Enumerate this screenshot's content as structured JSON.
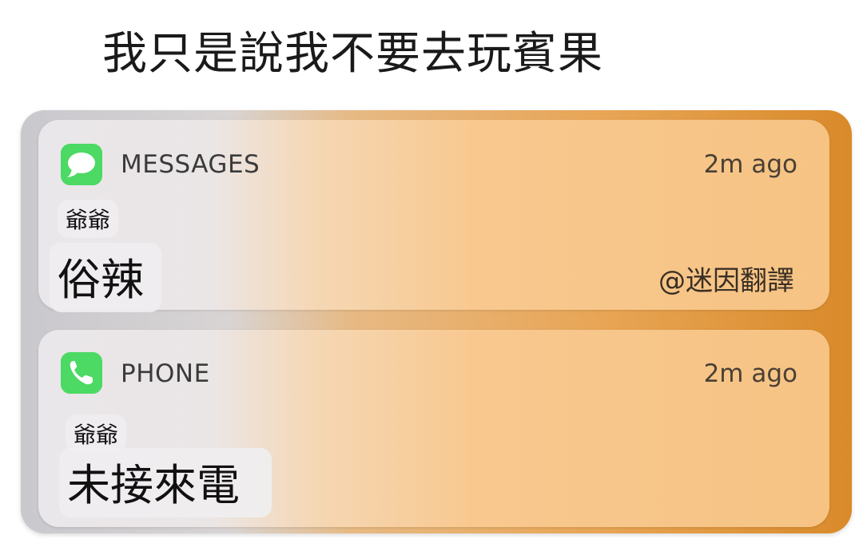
{
  "caption": "我只是說我不要去玩賓果",
  "notifications": [
    {
      "app_icon": "messages-app-icon",
      "app_name": "MESSAGES",
      "time": "2m ago",
      "sender": "爺爺",
      "body": "俗辣"
    },
    {
      "app_icon": "phone-app-icon",
      "app_name": "PHONE",
      "time": "2m ago",
      "sender": "爺爺",
      "body": "未接來電"
    }
  ],
  "watermark": "@迷因翻譯",
  "colors": {
    "icon_green": "#4cd964",
    "card_orange": "#f6c383",
    "card_gray": "#e9e7ea"
  }
}
